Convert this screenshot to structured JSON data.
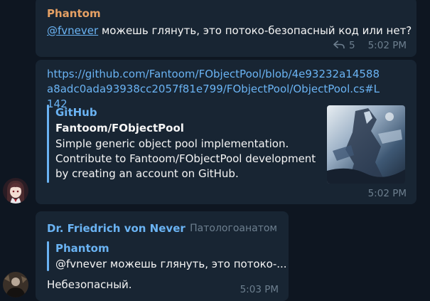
{
  "messages": {
    "m1": {
      "sender": "Phantom",
      "mention": "@fvnever",
      "text": " можешь глянуть, это потоко-безопасный код или нет?",
      "reply_count": "5",
      "time": "5:02 PM"
    },
    "m2": {
      "link": "https://github.com/Fantoom/FObjectPool/blob/4e93232a14588a8adc0ada93938cc2057f81e799/FObjectPool/ObjectPool.cs#L142",
      "preview": {
        "site": "GitHub",
        "title": "Fantoom/FObjectPool",
        "description": "Simple generic object pool implementation. Contribute to Fantoom/FObjectPool development by creating an account on GitHub."
      },
      "time": "5:02 PM"
    },
    "m3": {
      "sender": "Dr. Friedrich von Never",
      "role": "Патологоанатом",
      "quote": {
        "name": "Phantom",
        "text": "@fvnever можешь глянуть, это потоко-..."
      },
      "text": "Небезопасный.",
      "time": "5:03 PM"
    }
  },
  "colors": {
    "background": "#0e1621",
    "bubble": "#182533",
    "link": "#6ab3f3",
    "sender_orange": "#e5a064",
    "meta": "#6d7f8f",
    "text": "#f5f5f5"
  },
  "icons": {
    "reply": "reply-arrow-icon",
    "avatar_1": "anime-girl-avatar",
    "avatar_2": "dark-figure-avatar",
    "thumbnail": "repository-preview-thumbnail"
  }
}
